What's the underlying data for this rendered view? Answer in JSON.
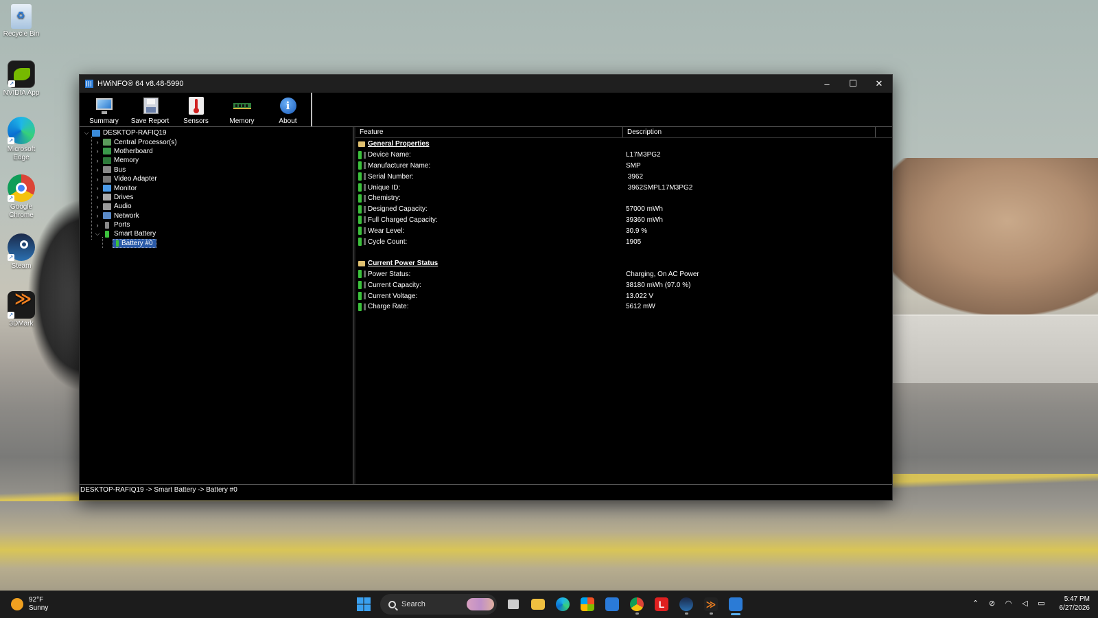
{
  "desktop": {
    "icons": [
      {
        "label": "Recycle Bin"
      },
      {
        "label": "NVIDIA App"
      },
      {
        "label": "Microsoft Edge"
      },
      {
        "label": "Google Chrome"
      },
      {
        "label": "Steam"
      },
      {
        "label": "3DMark"
      }
    ]
  },
  "window": {
    "title": "HWiNFO® 64 v8.48-5990",
    "controls": {
      "minimize": "–",
      "maximize": "☐",
      "close": "✕"
    }
  },
  "toolbar": {
    "buttons": [
      {
        "label": "Summary",
        "icon": "monitor-icon"
      },
      {
        "label": "Save Report",
        "icon": "floppy-disk-icon"
      },
      {
        "label": "Sensors",
        "icon": "thermometer-icon"
      },
      {
        "label": "Memory",
        "icon": "ram-stick-icon"
      },
      {
        "label": "About",
        "icon": "info-icon"
      }
    ]
  },
  "tree": {
    "root": "DESKTOP-RAFIQ19",
    "items": [
      {
        "label": "Central Processor(s)"
      },
      {
        "label": "Motherboard"
      },
      {
        "label": "Memory"
      },
      {
        "label": "Bus"
      },
      {
        "label": "Video Adapter"
      },
      {
        "label": "Monitor"
      },
      {
        "label": "Drives"
      },
      {
        "label": "Audio"
      },
      {
        "label": "Network"
      },
      {
        "label": "Ports"
      },
      {
        "label": "Smart Battery"
      }
    ],
    "selected_child": "Battery #0"
  },
  "details": {
    "columns": {
      "feature": "Feature",
      "description": "Description"
    },
    "general": {
      "title": "General Properties",
      "rows": [
        {
          "feature": "Device Name:",
          "value": "L17M3PG2"
        },
        {
          "feature": "Manufacturer Name:",
          "value": "SMP"
        },
        {
          "feature": "Serial Number:",
          "value": " 3962"
        },
        {
          "feature": "Unique ID:",
          "value": " 3962SMPL17M3PG2"
        },
        {
          "feature": "Chemistry:",
          "value": ""
        },
        {
          "feature": "Designed Capacity:",
          "value": "57000 mWh"
        },
        {
          "feature": "Full Charged Capacity:",
          "value": "39360 mWh"
        },
        {
          "feature": "Wear Level:",
          "value": "30.9 %"
        },
        {
          "feature": "Cycle Count:",
          "value": "1905"
        }
      ]
    },
    "power": {
      "title": "Current Power Status",
      "rows": [
        {
          "feature": "Power Status:",
          "value": "Charging, On AC Power"
        },
        {
          "feature": "Current Capacity:",
          "value": "38180 mWh (97.0 %)"
        },
        {
          "feature": "Current Voltage:",
          "value": "13.022 V"
        },
        {
          "feature": "Charge Rate:",
          "value": "5612 mW"
        }
      ]
    }
  },
  "statusbar": {
    "path": "DESKTOP-RAFIQ19 -> Smart Battery -> Battery #0"
  },
  "taskbar": {
    "weather": {
      "temp": "92°F",
      "condition": "Sunny"
    },
    "search_placeholder": "Search",
    "clock": {
      "time": "5:47 PM",
      "date": "6/27/2026"
    }
  }
}
